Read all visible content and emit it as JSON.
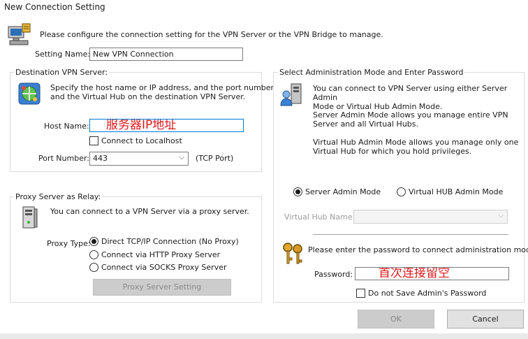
{
  "window": {
    "title": "New Connection Setting"
  },
  "header": {
    "intro": "Please configure the connection setting for the VPN Server or the VPN Bridge to manage."
  },
  "setting_name": {
    "label": "Setting Name:",
    "value": "New VPN Connection"
  },
  "destination": {
    "group_title": "Destination VPN Server:",
    "description_line1": "Specify the host name or IP address, and the port number",
    "description_line2": "and the Virtual Hub on the destination VPN Server.",
    "host_label": "Host Name:",
    "host_value": "服务器IP地址",
    "localhost_label": "Connect to Localhost",
    "port_label": "Port Number:",
    "port_value": "443",
    "port_suffix": "(TCP Port)"
  },
  "proxy": {
    "group_title": "Proxy Server as Relay:",
    "description": "You can connect to a VPN Server via a proxy server.",
    "type_label": "Proxy Type:",
    "options": [
      "Direct TCP/IP Connection (No Proxy)",
      "Connect via HTTP Proxy Server",
      "Connect via SOCKS Proxy Server"
    ],
    "selected_index": 0,
    "settings_button": "Proxy Server Setting"
  },
  "admin": {
    "group_title": "Select Administration Mode and Enter Password",
    "desc1_line1": "You can connect to VPN Server using either Server Admin",
    "desc1_line2": "Mode or Virtual Hub Admin Mode.",
    "desc2_line1": "Server Admin Mode allows you manage entire VPN",
    "desc2_line2": "Server and all Virtual Hubs.",
    "desc3_line1": "Virtual Hub Admin Mode allows you manage only one",
    "desc3_line2": "Virtual Hub for which you hold privileges.",
    "mode_server": "Server Admin Mode",
    "mode_hub": "Virtual HUB Admin Mode",
    "selected_mode": "server",
    "hub_name_label": "Virtual Hub Name:",
    "hub_name_value": "",
    "password_prompt": "Please enter the password to connect administration mode.",
    "password_label": "Password:",
    "password_value": "首次连接留空",
    "no_save_label": "Do not Save Admin's Password"
  },
  "footer": {
    "ok": "OK",
    "cancel": "Cancel"
  },
  "icons": [
    "computer-config-icon",
    "globe-network-icon",
    "server-tower-icon",
    "user-server-icon",
    "keys-icon",
    "chevron-down-icon"
  ]
}
